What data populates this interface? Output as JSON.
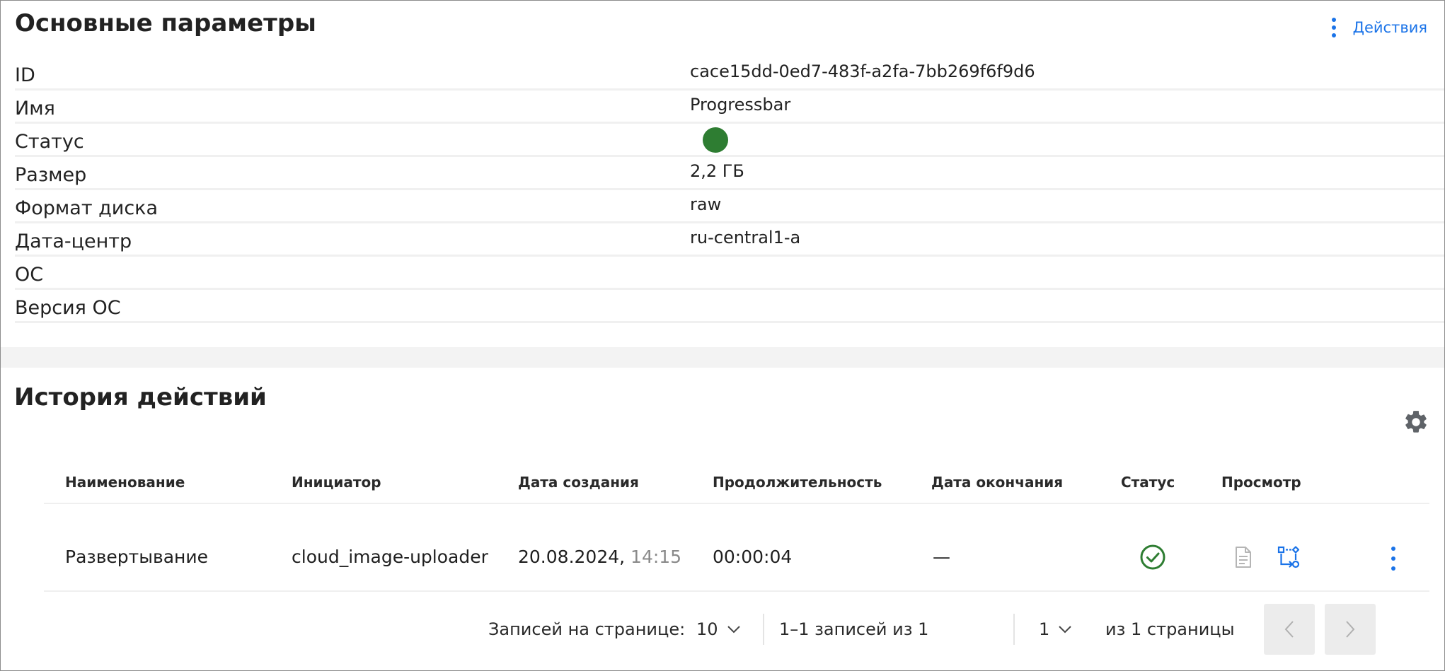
{
  "main_params": {
    "title": "Основные параметры",
    "actions_label": "Действия",
    "rows": [
      {
        "label": "ID",
        "value": "cace15dd-0ed7-483f-a2fa-7bb269f6f9d6"
      },
      {
        "label": "Имя",
        "value": "Progressbar"
      },
      {
        "label": "Статус",
        "value": "",
        "status_color": "#2e7d32"
      },
      {
        "label": "Размер",
        "value": "2,2 ГБ"
      },
      {
        "label": "Формат диска",
        "value": "raw"
      },
      {
        "label": "Дата-центр",
        "value": "ru-central1-a"
      },
      {
        "label": "ОС",
        "value": ""
      },
      {
        "label": "Версия ОС",
        "value": ""
      }
    ]
  },
  "history": {
    "title": "История действий",
    "columns": [
      "Наименование",
      "Инициатор",
      "Дата создания",
      "Продолжительность",
      "Дата окончания",
      "Статус",
      "Просмотр"
    ],
    "rows": [
      {
        "name": "Развертывание",
        "initiator": "cloud_image-uploader",
        "created_date": "20.08.2024,",
        "created_time": "14:15",
        "duration": "00:00:04",
        "end_date": "—",
        "status_icon": "check-circle-icon",
        "status_color": "#2e7d32"
      }
    ]
  },
  "pagination": {
    "per_page_label": "Записей на странице:",
    "per_page_value": "10",
    "range_text": "1–1 записей из 1",
    "page_value": "1",
    "page_total_text": "из 1 страницы"
  },
  "colors": {
    "accent": "#1a73e8",
    "success": "#2e7d32"
  }
}
